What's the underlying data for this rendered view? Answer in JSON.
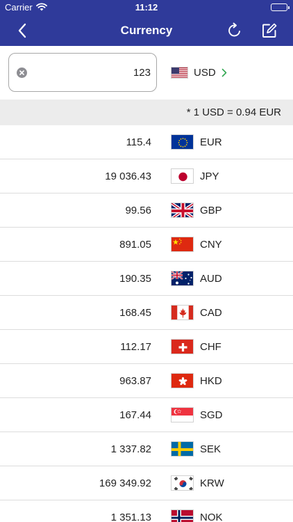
{
  "status_bar": {
    "carrier": "Carrier",
    "time": "11:12"
  },
  "nav": {
    "title": "Currency"
  },
  "input": {
    "value": "123"
  },
  "base": {
    "code": "USD",
    "flag": "us-flag-icon"
  },
  "rate": {
    "text": "* 1 USD = 0.94 EUR"
  },
  "currencies": [
    {
      "code": "EUR",
      "amount": "115.4",
      "flag": "eu-flag-icon"
    },
    {
      "code": "JPY",
      "amount": "19 036.43",
      "flag": "jp-flag-icon"
    },
    {
      "code": "GBP",
      "amount": "99.56",
      "flag": "gb-flag-icon"
    },
    {
      "code": "CNY",
      "amount": "891.05",
      "flag": "cn-flag-icon"
    },
    {
      "code": "AUD",
      "amount": "190.35",
      "flag": "au-flag-icon"
    },
    {
      "code": "CAD",
      "amount": "168.45",
      "flag": "ca-flag-icon"
    },
    {
      "code": "CHF",
      "amount": "112.17",
      "flag": "ch-flag-icon"
    },
    {
      "code": "HKD",
      "amount": "963.87",
      "flag": "hk-flag-icon"
    },
    {
      "code": "SGD",
      "amount": "167.44",
      "flag": "sg-flag-icon"
    },
    {
      "code": "SEK",
      "amount": "1 337.82",
      "flag": "se-flag-icon"
    },
    {
      "code": "KRW",
      "amount": "169 349.92",
      "flag": "kr-flag-icon"
    },
    {
      "code": "NOK",
      "amount": "1 351.13",
      "flag": "no-flag-icon"
    }
  ],
  "colors": {
    "header": "#2f3a9a",
    "chevron": "#34a853",
    "rate_bar": "#ececec"
  }
}
